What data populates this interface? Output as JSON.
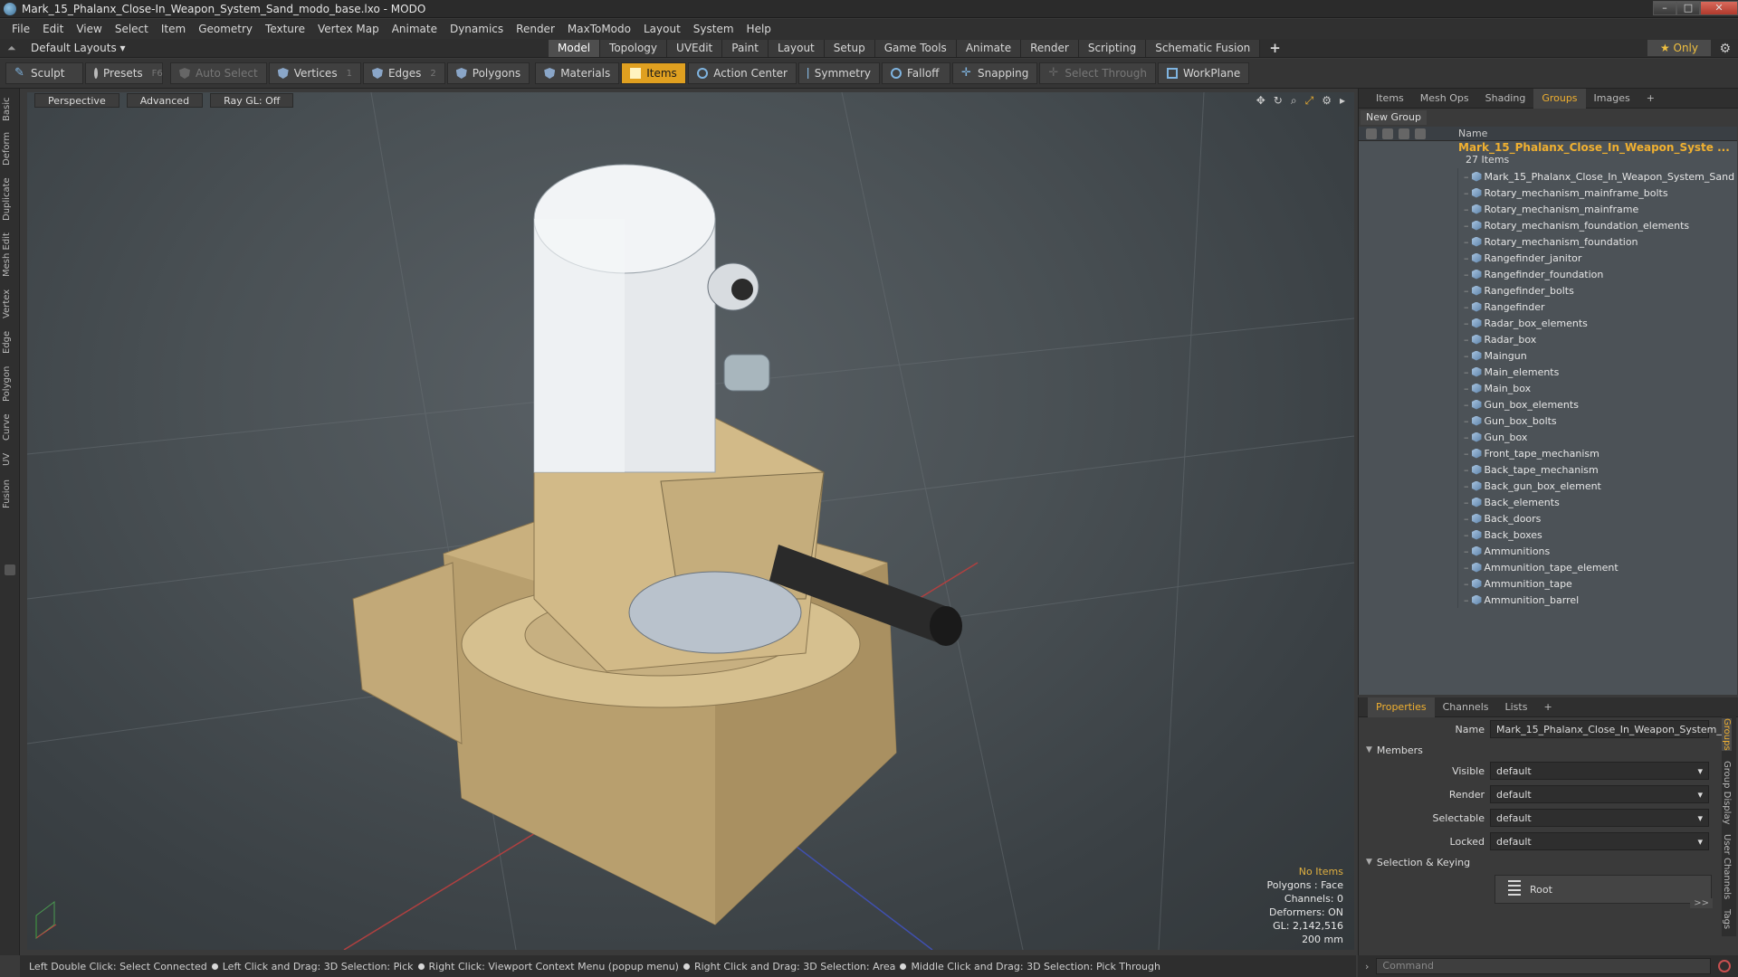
{
  "window": {
    "title": "Mark_15_Phalanx_Close-In_Weapon_System_Sand_modo_base.lxo - MODO"
  },
  "menu": [
    "File",
    "Edit",
    "View",
    "Select",
    "Item",
    "Geometry",
    "Texture",
    "Vertex Map",
    "Animate",
    "Dynamics",
    "Render",
    "MaxToModo",
    "Layout",
    "System",
    "Help"
  ],
  "layouts": {
    "label": "Default Layouts ▾"
  },
  "modeTabs": [
    "Model",
    "Topology",
    "UVEdit",
    "Paint",
    "Layout",
    "Setup",
    "Game Tools",
    "Animate",
    "Render",
    "Scripting",
    "Schematic Fusion"
  ],
  "activeModeTab": "Model",
  "only": "★  Only",
  "toolbar": {
    "sculpt": "Sculpt",
    "presets": "Presets",
    "presetsKey": "F6",
    "autoSelect": "Auto Select",
    "vertices": "Vertices",
    "verticesKey": "1",
    "edges": "Edges",
    "edgesKey": "2",
    "polygons": "Polygons",
    "materials": "Materials",
    "items": "Items",
    "actionCenter": "Action Center",
    "symmetry": "Symmetry",
    "falloff": "Falloff",
    "snapping": "Snapping",
    "selectThrough": "Select Through",
    "workplane": "WorkPlane"
  },
  "leftTabs": [
    "Basic",
    "Deform",
    "Duplicate",
    "Mesh Edit",
    "Vertex",
    "Edge",
    "Polygon",
    "Curve",
    "UV",
    "Fusion"
  ],
  "viewport": {
    "view": "Perspective",
    "advanced": "Advanced",
    "raygl": "Ray GL: Off",
    "stats": {
      "noItems": "No Items",
      "polygons": "Polygons : Face",
      "channels": "Channels: 0",
      "deformers": "Deformers: ON",
      "gl": "GL: 2,142,516",
      "scale": "200 mm"
    }
  },
  "statusbar": {
    "s1": "Left Double Click: Select Connected",
    "s2": "Left Click and Drag: 3D Selection: Pick",
    "s3": "Right Click: Viewport Context Menu (popup menu)",
    "s4": "Right Click and Drag: 3D Selection: Area",
    "s5": "Middle Click and Drag: 3D Selection: Pick Through"
  },
  "panel": {
    "tabs": [
      "Items",
      "Mesh Ops",
      "Shading",
      "Groups",
      "Images"
    ],
    "activeTab": "Groups",
    "newGroup": "New Group",
    "nameHeader": "Name",
    "group": {
      "title": "Mark_15_Phalanx_Close_In_Weapon_Syste ...",
      "count": "27 Items"
    },
    "items": [
      "Mark_15_Phalanx_Close_In_Weapon_System_Sand",
      "Rotary_mechanism_mainframe_bolts",
      "Rotary_mechanism_mainframe",
      "Rotary_mechanism_foundation_elements",
      "Rotary_mechanism_foundation",
      "Rangefinder_janitor",
      "Rangefinder_foundation",
      "Rangefinder_bolts",
      "Rangefinder",
      "Radar_box_elements",
      "Radar_box",
      "Maingun",
      "Main_elements",
      "Main_box",
      "Gun_box_elements",
      "Gun_box_bolts",
      "Gun_box",
      "Front_tape_mechanism",
      "Back_tape_mechanism",
      "Back_gun_box_element",
      "Back_elements",
      "Back_doors",
      "Back_boxes",
      "Ammunitions",
      "Ammunition_tape_element",
      "Ammunition_tape",
      "Ammunition_barrel"
    ]
  },
  "props": {
    "tabs": [
      "Properties",
      "Channels",
      "Lists"
    ],
    "activeTab": "Properties",
    "nameLabel": "Name",
    "nameValue": "Mark_15_Phalanx_Close_In_Weapon_System_S",
    "members": "Members",
    "visibleLabel": "Visible",
    "renderLabel": "Render",
    "selectableLabel": "Selectable",
    "lockedLabel": "Locked",
    "defaultValue": "default",
    "selKeying": "Selection & Keying",
    "root": "Root",
    "more": ">>",
    "sideTabs": [
      "Groups",
      "Group Display",
      "User Channels",
      "Tags"
    ]
  },
  "command": {
    "placeholder": "Command"
  }
}
